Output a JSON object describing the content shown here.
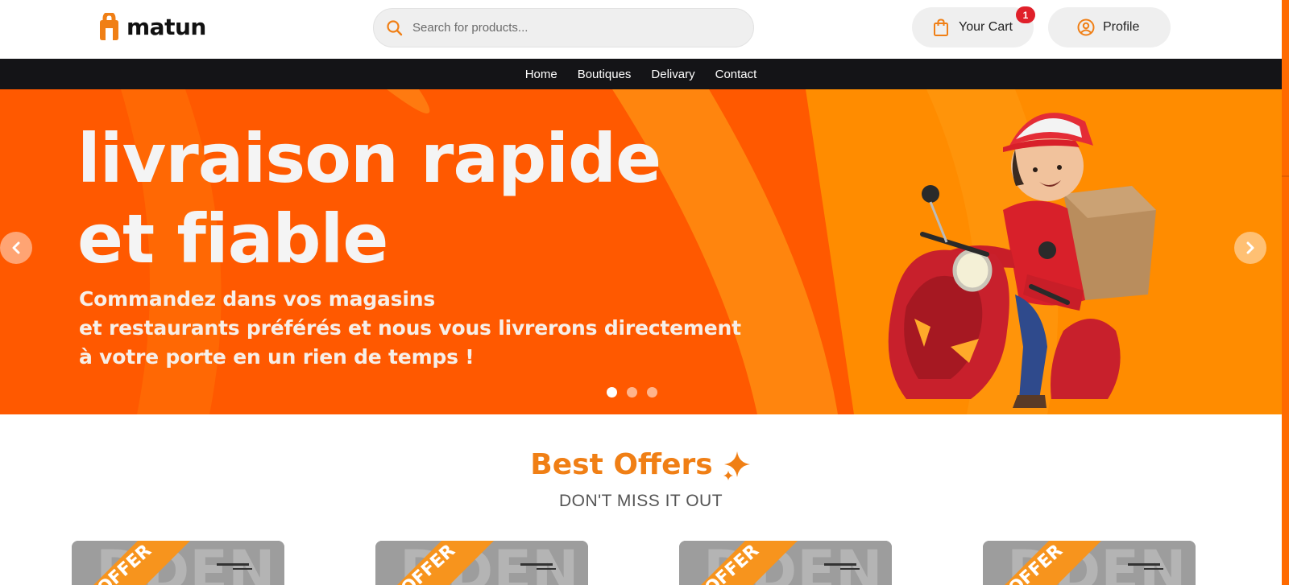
{
  "brand": {
    "name": "matun",
    "accent": "#f07f15"
  },
  "search": {
    "placeholder": "Search for products..."
  },
  "header": {
    "cart_label": "Your Cart",
    "cart_count": "1",
    "profile_label": "Profile"
  },
  "nav": {
    "items": [
      "Home",
      "Boutiques",
      "Delivary",
      "Contact"
    ]
  },
  "hero": {
    "title_line1": "livraison rapide",
    "title_line2": "et fiable",
    "sub_line1": "Commandez dans vos magasins",
    "sub_line2": "et restaurants préférés et nous vous livrerons directement",
    "sub_line3": "à votre porte en un rien de temps !",
    "slide_count": 3,
    "active_slide": 1
  },
  "offers": {
    "heading": "Best Offers",
    "subheading": "DON'T MISS IT OUT",
    "ribbon_text": "OFFER"
  }
}
